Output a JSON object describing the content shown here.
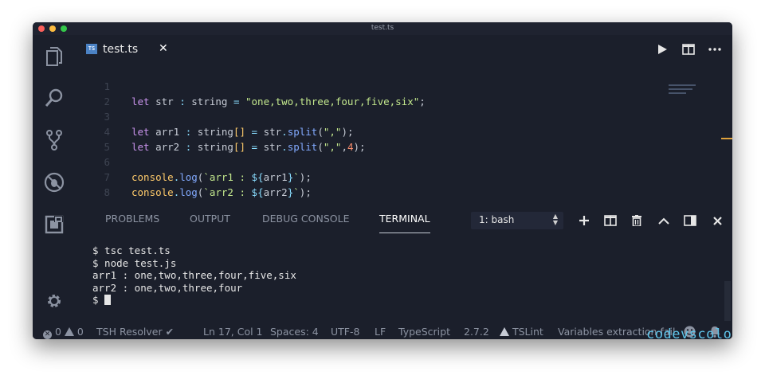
{
  "window": {
    "title": "test.ts"
  },
  "activity_bar": {
    "icons": [
      "explorer-icon",
      "search-icon",
      "source-control-icon",
      "debug-icon",
      "extensions-icon",
      "gear-icon"
    ]
  },
  "tab": {
    "label": "test.ts",
    "icon_text": "TS",
    "close_glyph": "✕"
  },
  "editor_actions": [
    "run-icon",
    "split-editor-icon",
    "more-icon"
  ],
  "editor": {
    "line_numbers": [
      "1",
      "2",
      "3",
      "4",
      "5",
      "6",
      "7",
      "8"
    ],
    "line1": {
      "let": "let",
      "name": "str",
      "colon": " : ",
      "type": "string",
      "eq": " = ",
      "value": "\"one,two,three,four,five,six\"",
      "semi": ";"
    },
    "line3": {
      "let": "let",
      "name": "arr1",
      "colon": " : ",
      "type": "string",
      "brackets": "[]",
      "eq": " = ",
      "obj": "str",
      "dot": ".",
      "fn": "split",
      "open": "(",
      "arg": "\",\"",
      "close": ")",
      "semi": ";"
    },
    "line4": {
      "let": "let",
      "name": "arr2",
      "colon": " : ",
      "type": "string",
      "brackets": "[]",
      "eq": " = ",
      "obj": "str",
      "dot": ".",
      "fn": "split",
      "open": "(",
      "arg": "\",\"",
      "comma": ",",
      "num": "4",
      "close": ")",
      "semi": ";"
    },
    "line6": {
      "obj": "console",
      "dot": ".",
      "fn": "log",
      "open": "(",
      "tick": "`",
      "text": "arr1 : ",
      "interp_open": "${",
      "interp_var": "arr1",
      "interp_close": "}",
      "tick2": "`",
      "close": ")",
      "semi": ";"
    },
    "line7": {
      "obj": "console",
      "dot": ".",
      "fn": "log",
      "open": "(",
      "tick": "`",
      "text": "arr2 : ",
      "interp_open": "${",
      "interp_var": "arr2",
      "interp_close": "}",
      "tick2": "`",
      "close": ")",
      "semi": ";"
    }
  },
  "panel": {
    "tabs": [
      "PROBLEMS",
      "OUTPUT",
      "DEBUG CONSOLE",
      "TERMINAL"
    ],
    "active_tab": "TERMINAL",
    "terminal_select": "1: bash",
    "actions": [
      "add-icon",
      "split-terminal-icon",
      "trash-icon",
      "maximize-icon",
      "layout-icon",
      "close-icon"
    ],
    "terminal_lines": [
      "$ tsc test.ts",
      "$ node test.js",
      "arr1 : one,two,three,four,five,six",
      "arr2 : one,two,three,four"
    ],
    "prompt": "$ "
  },
  "status_bar": {
    "errors": "0",
    "warnings": "0",
    "tsh": "TSH Resolver ✔",
    "position": "Ln 17, Col 1",
    "spaces": "Spaces: 4",
    "encoding": "UTF-8",
    "eol": "LF",
    "language": "TypeScript",
    "version": "2.7.2",
    "tslint": "TSLint",
    "message": "Variables extraction fail"
  },
  "watermark": "codevscolor.com"
}
